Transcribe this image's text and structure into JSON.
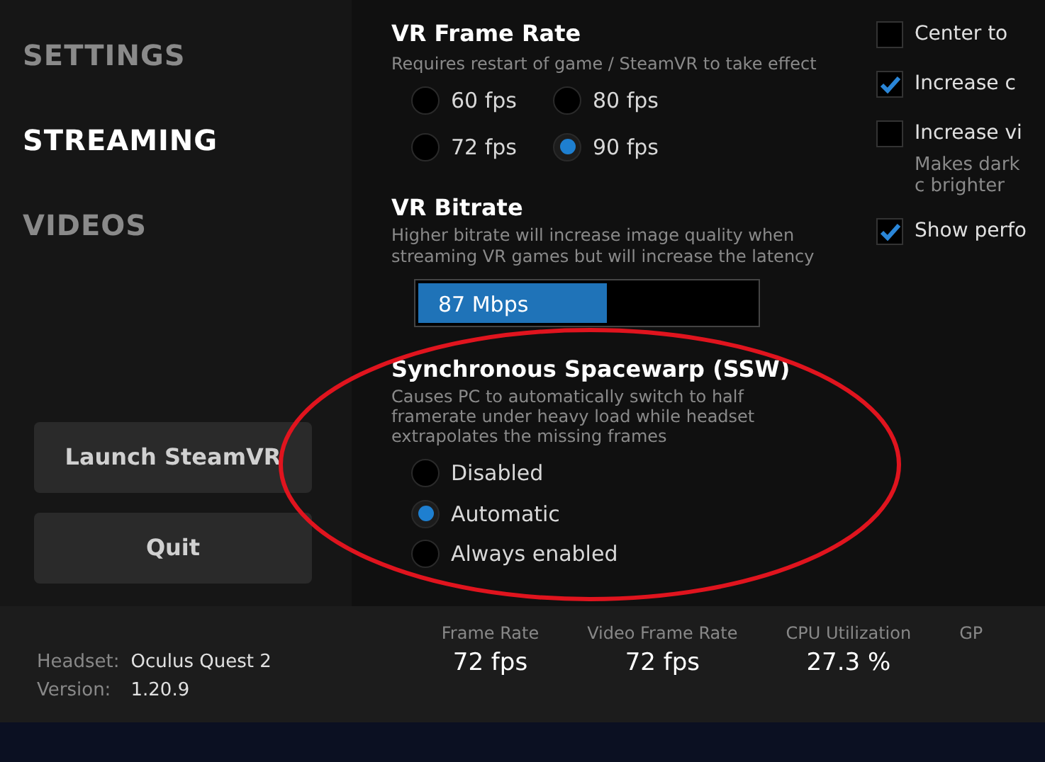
{
  "sidebar": {
    "items": [
      {
        "label": "SETTINGS",
        "selected": false
      },
      {
        "label": "STREAMING",
        "selected": true
      },
      {
        "label": "VIDEOS",
        "selected": false
      }
    ],
    "buttons": [
      "Launch SteamVR",
      "Quit"
    ]
  },
  "frame_rate": {
    "title": "VR Frame Rate",
    "hint": "Requires restart of game / SteamVR to take effect",
    "options": [
      {
        "label": "60 fps",
        "selected": false
      },
      {
        "label": "80 fps",
        "selected": false
      },
      {
        "label": "72 fps",
        "selected": false
      },
      {
        "label": "90 fps",
        "selected": true
      }
    ]
  },
  "bitrate": {
    "title": "VR Bitrate",
    "hint": "Higher bitrate will increase image quality when streaming VR games but will increase the latency",
    "value": "87 Mbps",
    "level": 0.56
  },
  "ssw": {
    "title": "Synchronous Spacewarp (SSW)",
    "hint": "Causes PC to automatically switch to half framerate under heavy load while headset extrapolates the missing frames",
    "options": [
      {
        "label": "Disabled",
        "selected": false
      },
      {
        "label": "Automatic",
        "selected": true
      },
      {
        "label": "Always enabled",
        "selected": false
      }
    ]
  },
  "options": [
    {
      "label": "Center to",
      "checked": false
    },
    {
      "label": "Increase c",
      "checked": true
    },
    {
      "label": "Increase vi",
      "checked": false,
      "hint": "Makes dark c brighter"
    },
    {
      "label": "Show perfo",
      "checked": true
    }
  ],
  "status_bar": {
    "headset_label": "Headset:",
    "headset": "Oculus Quest 2",
    "version_label": "Version:",
    "version": "1.20.9",
    "stats": [
      {
        "label": "Frame Rate",
        "value": "72 fps"
      },
      {
        "label": "Video Frame Rate",
        "value": "72 fps"
      },
      {
        "label": "CPU Utilization",
        "value": "27.3 %"
      },
      {
        "label": "GP"
      }
    ]
  }
}
